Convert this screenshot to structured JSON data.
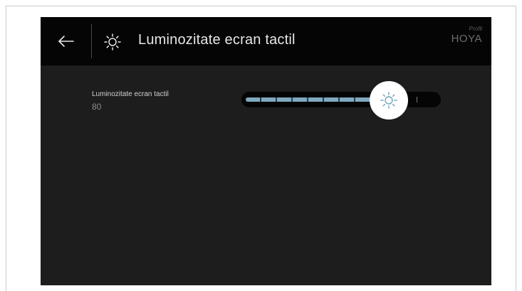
{
  "header": {
    "back_icon": "arrow-left-icon",
    "title_icon": "sun-icon",
    "title": "Luminozitate ecran tactil",
    "profile_label": "Profil",
    "profile_name": "HOYA"
  },
  "setting": {
    "label": "Luminozitate ecran tactil",
    "value": "80",
    "level": 0.75,
    "knob_icon": "sun-icon"
  },
  "colors": {
    "screen_background": "#1d1d1d",
    "header_background": "#050505",
    "slider_fill": "#7fa9c0",
    "knob": "#ffffff",
    "knob_icon": "#6fa1bb"
  }
}
